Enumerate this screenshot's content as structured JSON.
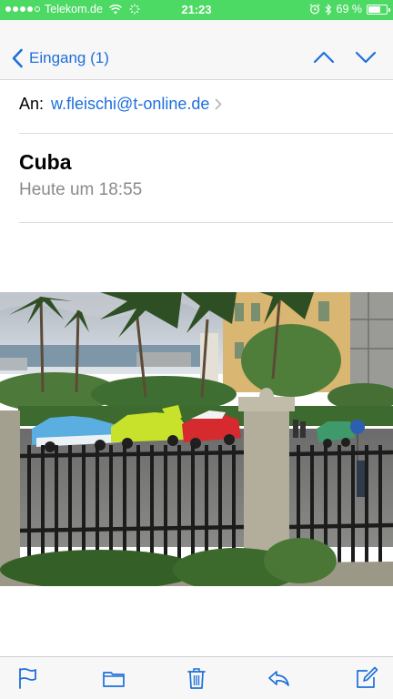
{
  "status_bar": {
    "carrier": "Telekom.de",
    "time": "21:23",
    "battery": "69 %",
    "battery_level": 0.69,
    "signal_bars": 4,
    "background": "#4cd964"
  },
  "nav": {
    "back_label": "Eingang (1)",
    "accent": "#1e6fd9"
  },
  "message": {
    "to_label": "An:",
    "to_address": "w.fleischi@t-online.de",
    "subject": "Cuba",
    "date": "Heute um 18:55"
  },
  "attachment": {
    "type": "photo",
    "icons": "photo of classic convertible cars behind an iron fence under palm trees"
  },
  "toolbar": {
    "icons": [
      "flag-icon",
      "folder-icon",
      "trash-icon",
      "reply-icon",
      "compose-icon"
    ]
  }
}
